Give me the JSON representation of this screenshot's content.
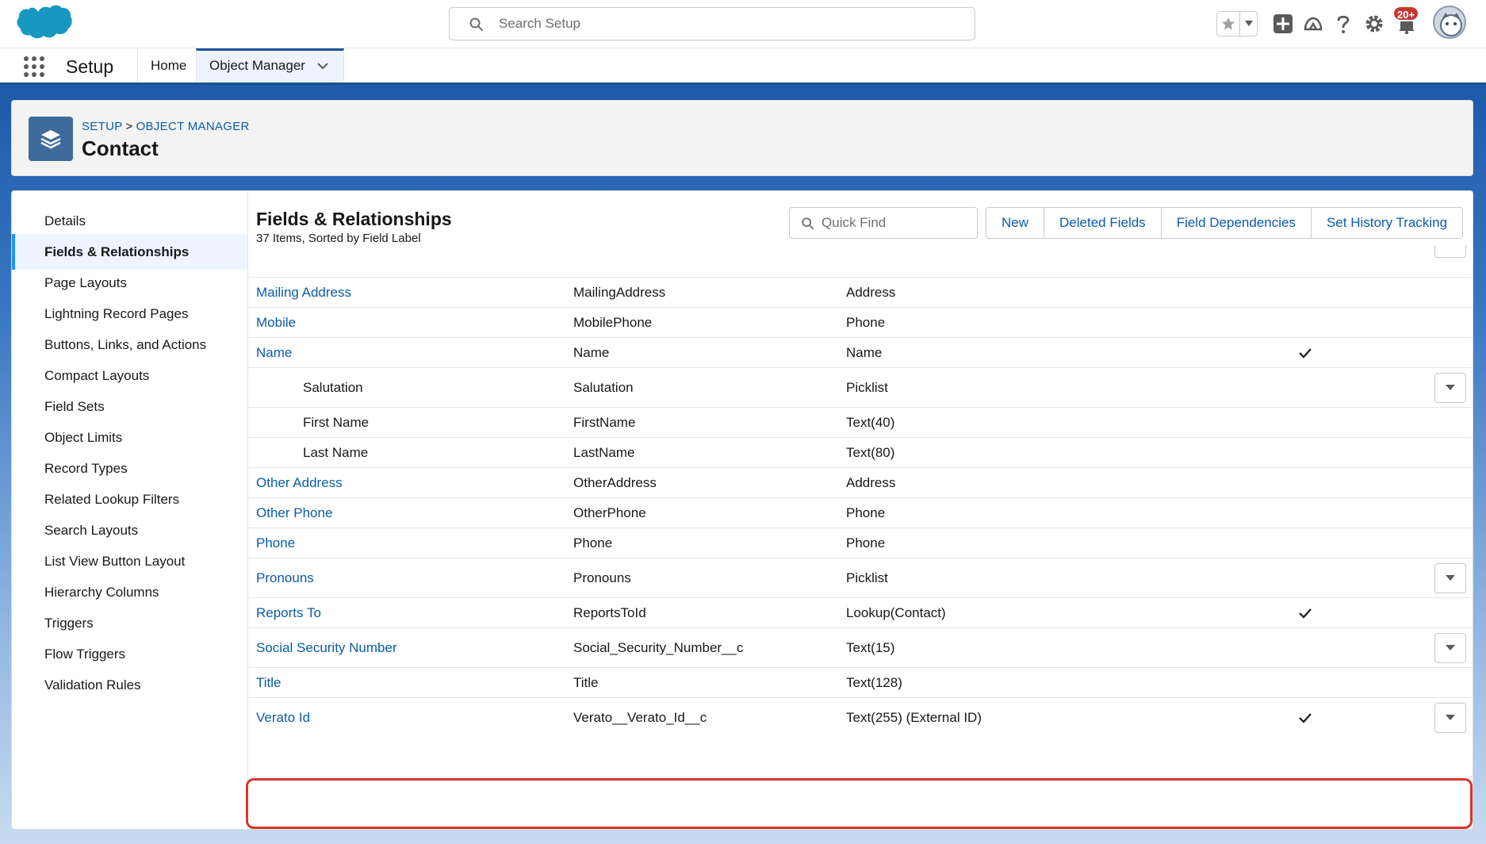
{
  "header": {
    "search_placeholder": "Search Setup",
    "notification_count": "20+"
  },
  "app_nav": {
    "app_name": "Setup",
    "tabs": [
      {
        "label": "Home"
      },
      {
        "label": "Object Manager"
      }
    ]
  },
  "page_header": {
    "breadcrumb": [
      "SETUP",
      "OBJECT MANAGER"
    ],
    "breadcrumb_separator": ">",
    "title": "Contact"
  },
  "sidebar": {
    "items": [
      {
        "label": "Details"
      },
      {
        "label": "Fields & Relationships"
      },
      {
        "label": "Page Layouts"
      },
      {
        "label": "Lightning Record Pages"
      },
      {
        "label": "Buttons, Links, and Actions"
      },
      {
        "label": "Compact Layouts"
      },
      {
        "label": "Field Sets"
      },
      {
        "label": "Object Limits"
      },
      {
        "label": "Record Types"
      },
      {
        "label": "Related Lookup Filters"
      },
      {
        "label": "Search Layouts"
      },
      {
        "label": "List View Button Layout"
      },
      {
        "label": "Hierarchy Columns"
      },
      {
        "label": "Triggers"
      },
      {
        "label": "Flow Triggers"
      },
      {
        "label": "Validation Rules"
      }
    ],
    "active_index": 1
  },
  "section": {
    "title": "Fields & Relationships",
    "subtitle": "37 Items, Sorted by Field Label",
    "quick_find_placeholder": "Quick Find",
    "buttons": {
      "new": "New",
      "deleted_fields": "Deleted Fields",
      "field_dependencies": "Field Dependencies",
      "set_history_tracking": "Set History Tracking"
    }
  },
  "fields": [
    {
      "label": "Mailing Address",
      "api_name": "MailingAddress",
      "type": "Address",
      "indexed": false,
      "has_action": false,
      "is_link": true
    },
    {
      "label": "Mobile",
      "api_name": "MobilePhone",
      "type": "Phone",
      "indexed": false,
      "has_action": false,
      "is_link": true
    },
    {
      "label": "Name",
      "api_name": "Name",
      "type": "Name",
      "indexed": true,
      "has_action": false,
      "is_link": true
    },
    {
      "label": "Salutation",
      "api_name": "Salutation",
      "type": "Picklist",
      "indexed": false,
      "has_action": true,
      "is_link": false
    },
    {
      "label": "First Name",
      "api_name": "FirstName",
      "type": "Text(40)",
      "indexed": false,
      "has_action": false,
      "is_link": false
    },
    {
      "label": "Last Name",
      "api_name": "LastName",
      "type": "Text(80)",
      "indexed": false,
      "has_action": false,
      "is_link": false
    },
    {
      "label": "Other Address",
      "api_name": "OtherAddress",
      "type": "Address",
      "indexed": false,
      "has_action": false,
      "is_link": true
    },
    {
      "label": "Other Phone",
      "api_name": "OtherPhone",
      "type": "Phone",
      "indexed": false,
      "has_action": false,
      "is_link": true
    },
    {
      "label": "Phone",
      "api_name": "Phone",
      "type": "Phone",
      "indexed": false,
      "has_action": false,
      "is_link": true
    },
    {
      "label": "Pronouns",
      "api_name": "Pronouns",
      "type": "Picklist",
      "indexed": false,
      "has_action": true,
      "is_link": true
    },
    {
      "label": "Reports To",
      "api_name": "ReportsToId",
      "type": "Lookup(Contact)",
      "indexed": true,
      "has_action": false,
      "is_link": true
    },
    {
      "label": "Social Security Number",
      "api_name": "Social_Security_Number__c",
      "type": "Text(15)",
      "indexed": false,
      "has_action": true,
      "is_link": true
    },
    {
      "label": "Title",
      "api_name": "Title",
      "type": "Text(128)",
      "indexed": false,
      "has_action": false,
      "is_link": true
    },
    {
      "label": "Verato Id",
      "api_name": "Verato__Verato_Id__c",
      "type": "Text(255) (External ID)",
      "indexed": true,
      "has_action": true,
      "is_link": true
    }
  ],
  "colors": {
    "brand_blue": "#1b5297",
    "link_blue": "#0b5cab",
    "highlight_red": "#d8342e",
    "badge_red": "#c23934",
    "active_nav_bg": "#eef4ff"
  }
}
